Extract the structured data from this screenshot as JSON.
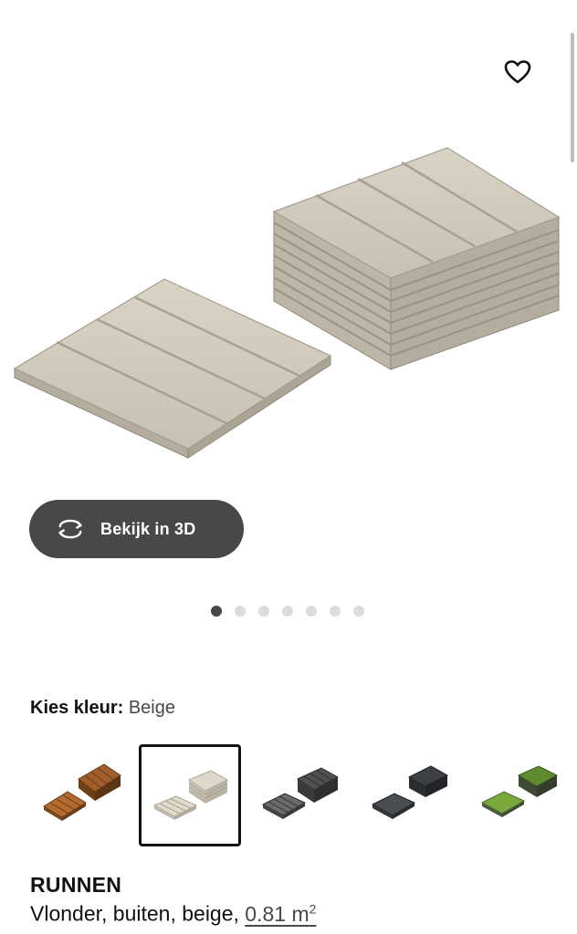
{
  "product": {
    "name": "RUNNEN",
    "description": "Vlonder, buiten, beige,",
    "area_value": "0.81 m",
    "area_sup": "2"
  },
  "viewer": {
    "view_3d_label": "Bekijk in 3D",
    "favorite_icon": "heart-outline-icon",
    "rotate_icon": "rotate-3d-icon",
    "image_count": 7,
    "active_image": 1
  },
  "color_picker": {
    "label": "Kies kleur:",
    "selected": "Beige",
    "options": [
      {
        "color": "#a0602d",
        "icon": "swatch-brown-tiles"
      },
      {
        "color": "#d6d0c0",
        "icon": "swatch-beige-tiles"
      },
      {
        "color": "#5a5a5a",
        "icon": "swatch-grey-tiles"
      },
      {
        "color": "#3a3d42",
        "icon": "swatch-dark-grey-tiles"
      },
      {
        "color": "#6f9a35",
        "icon": "swatch-green-grass-tiles"
      }
    ]
  },
  "colors": {
    "button_bg": "#484848",
    "dot_active": "#484848",
    "dot_inactive": "#dcdcdc"
  }
}
